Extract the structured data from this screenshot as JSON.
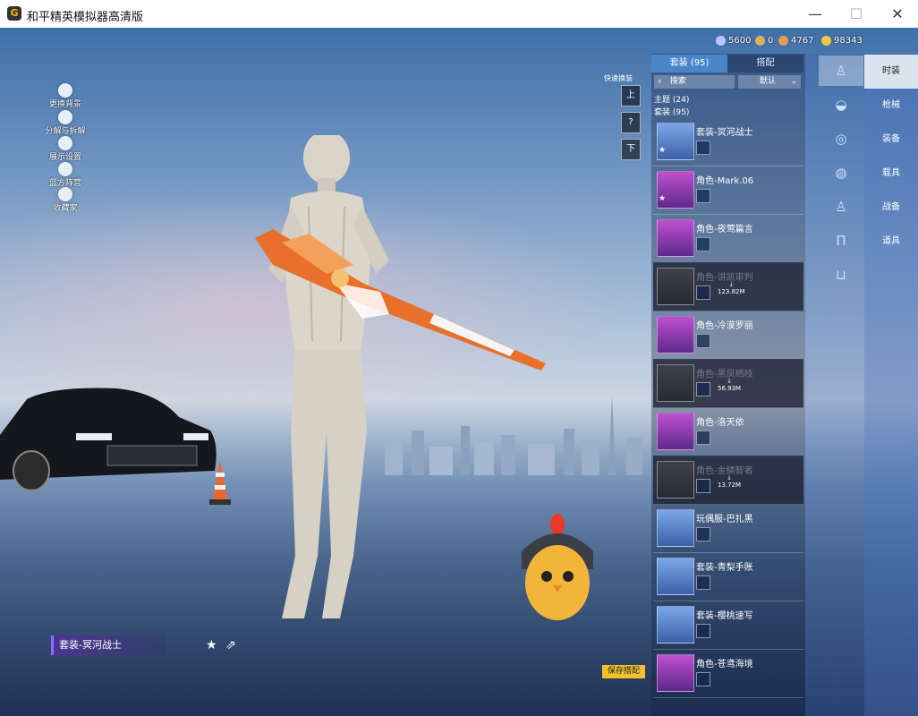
{
  "window": {
    "title": "和平精英模拟器高清版",
    "minimize_glyph": "—",
    "maximize_glyph": "☐",
    "close_glyph": "✕"
  },
  "left_toolbar": [
    {
      "label": "更换背景",
      "icon": "person-icon"
    },
    {
      "label": "分解与拆解",
      "icon": "puzzle-icon"
    },
    {
      "label": "展示设置",
      "icon": "eye-icon"
    },
    {
      "label": "蓝方阵营",
      "icon": "faction-icon"
    },
    {
      "label": "收藏家",
      "icon": "trophy-icon"
    }
  ],
  "currencies": [
    {
      "icon": "silver-coin-icon",
      "value": "5600",
      "color": "#b9c6ff"
    },
    {
      "icon": "coupon-icon",
      "value": "0",
      "color": "#d9b35a"
    },
    {
      "icon": "bronze-coin-icon",
      "value": "4767",
      "color": "#e0a050"
    },
    {
      "icon": "gold-coin-icon",
      "value": "98343",
      "color": "#f2c744"
    }
  ],
  "quick_change": {
    "label": "快速换装",
    "buttons": [
      "上",
      "?",
      "下"
    ]
  },
  "panel": {
    "tabs": [
      {
        "label": "套装 (95)",
        "active": true
      },
      {
        "label": "搭配",
        "active": false
      }
    ],
    "search_placeholder": "搜索",
    "sort_label": "默认",
    "sections": [
      "主题 (24)",
      "套装 (95)"
    ],
    "items": [
      {
        "name": "套装-冥河战士",
        "style": "blue",
        "dark": false,
        "star": true,
        "download": ""
      },
      {
        "name": "角色-Mark.06",
        "style": "purple",
        "dark": false,
        "star": true,
        "download": ""
      },
      {
        "name": "角色-夜莺篇言",
        "style": "purple",
        "dark": false,
        "star": false,
        "download": ""
      },
      {
        "name": "角色-讲凯审判",
        "style": "grey",
        "dark": true,
        "star": false,
        "download": "123.82M"
      },
      {
        "name": "角色-冷漠罗丽",
        "style": "purple",
        "dark": false,
        "star": false,
        "download": ""
      },
      {
        "name": "角色-黑凤栖枝",
        "style": "grey",
        "dark": true,
        "star": false,
        "download": "56.93M"
      },
      {
        "name": "角色-洛天依",
        "style": "purple",
        "dark": false,
        "star": false,
        "download": ""
      },
      {
        "name": "角色-金鳞智者",
        "style": "grey",
        "dark": true,
        "star": false,
        "download": "13.72M"
      },
      {
        "name": "玩偶服-巴扎黑",
        "style": "blue",
        "dark": false,
        "star": false,
        "download": ""
      },
      {
        "name": "套装-青梨手账",
        "style": "blue",
        "dark": false,
        "star": false,
        "download": ""
      },
      {
        "name": "套装-樱桃速写",
        "style": "blue",
        "dark": false,
        "star": false,
        "download": ""
      },
      {
        "name": "角色-苍鸢海境",
        "style": "purple",
        "dark": false,
        "star": false,
        "download": ""
      }
    ]
  },
  "category_icons": [
    "outfit-icon",
    "hat-icon",
    "goggles-icon",
    "mask-icon",
    "top-icon",
    "pants-icon",
    "shoes-icon"
  ],
  "nav_tabs": [
    {
      "label": "时装",
      "active": true
    },
    {
      "label": "枪械",
      "active": false
    },
    {
      "label": "装备",
      "active": false
    },
    {
      "label": "载具",
      "active": false
    },
    {
      "label": "战备",
      "active": false
    },
    {
      "label": "道具",
      "active": false
    }
  ],
  "current_outfit": "套装-冥河战士",
  "save_button": "保存搭配"
}
